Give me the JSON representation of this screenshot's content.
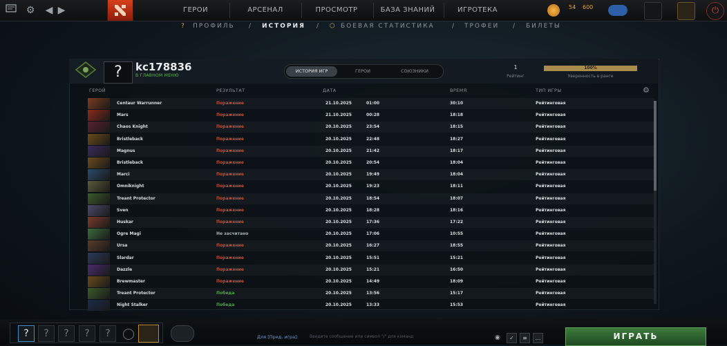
{
  "topbar": {
    "nav": [
      "ГЕРОИ",
      "АРСЕНАЛ",
      "ПРОСМОТР",
      "БАЗА ЗНАНИЙ",
      "ИГРОТЕКА"
    ],
    "currency": {
      "shards": "54",
      "gold": "600"
    }
  },
  "subnav": {
    "items": [
      "ПРОФИЛЬ",
      "ИСТОРИЯ",
      "БОЕВАЯ СТАТИСТИКА",
      "ТРОФЕИ",
      "БИЛЕТЫ"
    ],
    "active": "ИСТОРИЯ",
    "sep": "/"
  },
  "profile": {
    "avatar_glyph": "?",
    "username": "kc178836",
    "status": "В ГЛАВНОМ МЕНЮ",
    "tabs": [
      "ИСТОРИЯ ИГР",
      "ГЕРОИ",
      "СОЮЗНИКИ"
    ],
    "active_tab": "ИСТОРИЯ ИГР",
    "rating_value": "1",
    "rating_label": "Рейтинг",
    "confidence_value": "100%",
    "confidence_fraction": 1.0,
    "confidence_label": "Уверенность в ранге"
  },
  "columns": {
    "hero": "ГЕРОЙ",
    "result": "РЕЗУЛЬТАТ",
    "date": "ДАТА",
    "time": "ВРЕМЯ",
    "type": "ТИП ИГРЫ"
  },
  "matches": [
    {
      "hero": "Centaur Warrunner",
      "result": "Поражение",
      "outcome": "loss",
      "date": "21.10.2025",
      "clock": "01:00",
      "duration": "30:10",
      "type": "Рейтинговая"
    },
    {
      "hero": "Mars",
      "result": "Поражение",
      "outcome": "loss",
      "date": "21.10.2025",
      "clock": "00:28",
      "duration": "18:18",
      "type": "Рейтинговая"
    },
    {
      "hero": "Chaos Knight",
      "result": "Поражение",
      "outcome": "loss",
      "date": "20.10.2025",
      "clock": "23:54",
      "duration": "18:15",
      "type": "Рейтинговая"
    },
    {
      "hero": "Bristleback",
      "result": "Поражение",
      "outcome": "loss",
      "date": "20.10.2025",
      "clock": "22:48",
      "duration": "18:27",
      "type": "Рейтинговая"
    },
    {
      "hero": "Magnus",
      "result": "Поражение",
      "outcome": "loss",
      "date": "20.10.2025",
      "clock": "21:42",
      "duration": "18:17",
      "type": "Рейтинговая"
    },
    {
      "hero": "Bristleback",
      "result": "Поражение",
      "outcome": "loss",
      "date": "20.10.2025",
      "clock": "20:54",
      "duration": "18:04",
      "type": "Рейтинговая"
    },
    {
      "hero": "Marci",
      "result": "Поражение",
      "outcome": "loss",
      "date": "20.10.2025",
      "clock": "19:49",
      "duration": "18:04",
      "type": "Рейтинговая"
    },
    {
      "hero": "Omniknight",
      "result": "Поражение",
      "outcome": "loss",
      "date": "20.10.2025",
      "clock": "19:23",
      "duration": "18:11",
      "type": "Рейтинговая"
    },
    {
      "hero": "Treant Protector",
      "result": "Поражение",
      "outcome": "loss",
      "date": "20.10.2025",
      "clock": "18:54",
      "duration": "18:07",
      "type": "Рейтинговая"
    },
    {
      "hero": "Sven",
      "result": "Поражение",
      "outcome": "loss",
      "date": "20.10.2025",
      "clock": "18:28",
      "duration": "18:16",
      "type": "Рейтинговая"
    },
    {
      "hero": "Huskar",
      "result": "Поражение",
      "outcome": "loss",
      "date": "20.10.2025",
      "clock": "17:36",
      "duration": "17:22",
      "type": "Рейтинговая"
    },
    {
      "hero": "Ogre Magi",
      "result": "Не засчитано",
      "outcome": "aband",
      "date": "20.10.2025",
      "clock": "17:06",
      "duration": "10:55",
      "type": "Рейтинговая"
    },
    {
      "hero": "Ursa",
      "result": "Поражение",
      "outcome": "loss",
      "date": "20.10.2025",
      "clock": "16:27",
      "duration": "18:55",
      "type": "Рейтинговая"
    },
    {
      "hero": "Slardar",
      "result": "Поражение",
      "outcome": "loss",
      "date": "20.10.2025",
      "clock": "15:51",
      "duration": "15:21",
      "type": "Рейтинговая"
    },
    {
      "hero": "Dazzle",
      "result": "Поражение",
      "outcome": "loss",
      "date": "20.10.2025",
      "clock": "15:21",
      "duration": "16:50",
      "type": "Рейтинговая"
    },
    {
      "hero": "Brewmaster",
      "result": "Поражение",
      "outcome": "loss",
      "date": "20.10.2025",
      "clock": "14:49",
      "duration": "18:09",
      "type": "Рейтинговая"
    },
    {
      "hero": "Treant Protector",
      "result": "Победа",
      "outcome": "win",
      "date": "20.10.2025",
      "clock": "13:56",
      "duration": "15:17",
      "type": "Рейтинговая"
    },
    {
      "hero": "Night Stalker",
      "result": "Победа",
      "outcome": "win",
      "date": "20.10.2025",
      "clock": "13:33",
      "duration": "15:53",
      "type": "Рейтинговая"
    }
  ],
  "bottom": {
    "party_slots": [
      "?",
      "?",
      "?",
      "?",
      "?"
    ],
    "chat_label": "Для [Пред. игра]:",
    "chat_placeholder": "Введите сообщение или символ \"/\" для команд",
    "play": "ИГРАТЬ",
    "colors": {
      "loss": "#d24a2d",
      "win": "#4aa844",
      "accent": "#a78c4c"
    }
  }
}
